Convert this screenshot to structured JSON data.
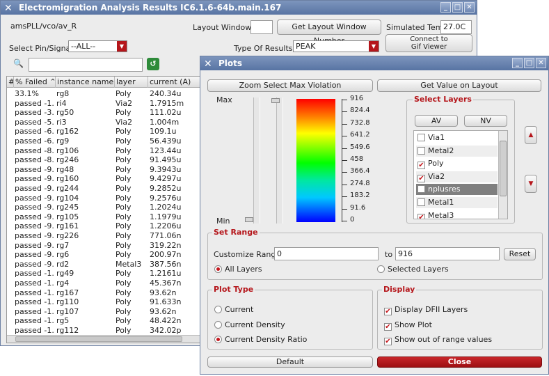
{
  "main_window": {
    "title": "Electromigration Analysis Results IC6.1.6-64b.main.167",
    "path": "amsPLL/vco/av_R",
    "layout_window_label": "Layout Window",
    "get_layout_window_button": "Get Layout Window Number",
    "simulated_temp_label": "Simulated Temp",
    "simulated_temp_value": "27.0C",
    "connect_gif_button_line1": "Connect to",
    "connect_gif_button_line2": "Gif Viewer",
    "select_pin_label": "Select Pin/Signal:",
    "select_pin_value": "--ALL--",
    "type_results_label": "Type Of Results:",
    "type_results_value": "PEAK",
    "columns": [
      "#",
      "% Failed",
      "instance name",
      "layer",
      "current (A)"
    ],
    "rows": [
      [
        "33.1%",
        "rg8",
        "Poly",
        "240.34u"
      ],
      [
        "passed -1...",
        "ri4",
        "Via2",
        "1.7915m"
      ],
      [
        "passed -3...",
        "rg50",
        "Poly",
        "111.02u"
      ],
      [
        "passed -5...",
        "ri3",
        "Via2",
        "1.004m"
      ],
      [
        "passed -6...",
        "rg162",
        "Poly",
        "109.1u"
      ],
      [
        "passed -6...",
        "rg9",
        "Poly",
        "56.439u"
      ],
      [
        "passed -8...",
        "rg106",
        "Poly",
        "123.44u"
      ],
      [
        "passed -8...",
        "rg246",
        "Poly",
        "91.495u"
      ],
      [
        "passed -9...",
        "rg48",
        "Poly",
        "9.3943u"
      ],
      [
        "passed -9...",
        "rg160",
        "Poly",
        "9.4297u"
      ],
      [
        "passed -9...",
        "rg244",
        "Poly",
        "9.2852u"
      ],
      [
        "passed -9...",
        "rg104",
        "Poly",
        "9.2576u"
      ],
      [
        "passed -9...",
        "rg245",
        "Poly",
        "1.2024u"
      ],
      [
        "passed -9...",
        "rg105",
        "Poly",
        "1.1979u"
      ],
      [
        "passed -9...",
        "rg161",
        "Poly",
        "1.2206u"
      ],
      [
        "passed -9...",
        "rg226",
        "Poly",
        "771.06n"
      ],
      [
        "passed -9...",
        "rg7",
        "Poly",
        "319.22n"
      ],
      [
        "passed -9...",
        "rg6",
        "Poly",
        "200.97n"
      ],
      [
        "passed -9...",
        "rd2",
        "Metal3",
        "387.56n"
      ],
      [
        "passed -1...",
        "rg49",
        "Poly",
        "1.2161u"
      ],
      [
        "passed -1...",
        "rg4",
        "Poly",
        "45.367n"
      ],
      [
        "passed -1...",
        "rg167",
        "Poly",
        "93.62n"
      ],
      [
        "passed -1...",
        "rg110",
        "Poly",
        "91.633n"
      ],
      [
        "passed -1...",
        "rg107",
        "Poly",
        "93.62n"
      ],
      [
        "passed -1...",
        "rg5",
        "Poly",
        "48.422n"
      ],
      [
        "passed -1...",
        "rg112",
        "Poly",
        "342.02p"
      ]
    ]
  },
  "plots_window": {
    "title": "Plots",
    "zoom_button": "Zoom Select Max Violation",
    "get_value_button": "Get Value on Layout",
    "max_label": "Max",
    "min_label": "Min",
    "scale_ticks": [
      "916",
      "824.4",
      "732.8",
      "641.2",
      "549.6",
      "458",
      "366.4",
      "274.8",
      "183.2",
      "91.6",
      "0"
    ],
    "select_layers_title": "Select Layers",
    "av_button": "AV",
    "nv_button": "NV",
    "layers": [
      {
        "name": "Via1",
        "checked": false,
        "selected": false
      },
      {
        "name": "Metal2",
        "checked": false,
        "selected": false
      },
      {
        "name": "Poly",
        "checked": true,
        "selected": false
      },
      {
        "name": "Via2",
        "checked": true,
        "selected": false
      },
      {
        "name": "nplusres",
        "checked": false,
        "selected": true
      },
      {
        "name": "Metal1",
        "checked": false,
        "selected": false
      },
      {
        "name": "Metal3",
        "checked": true,
        "selected": false
      }
    ],
    "set_range_title": "Set Range",
    "customize_range_label": "Customize Range",
    "range_from": "0",
    "range_to_label": "to",
    "range_to": "916",
    "reset_button": "Reset",
    "all_layers_label": "All Layers",
    "selected_layers_label": "Selected Layers",
    "plot_type_title": "Plot Type",
    "plot_types": [
      {
        "label": "Current",
        "selected": false
      },
      {
        "label": "Current Density",
        "selected": false
      },
      {
        "label": "Current Density Ratio",
        "selected": true
      }
    ],
    "display_title": "Display",
    "display_options": [
      {
        "label": "Display DFII Layers",
        "checked": true
      },
      {
        "label": "Show Plot",
        "checked": true
      },
      {
        "label": "Show out of range values",
        "checked": true
      }
    ],
    "default_button": "Default",
    "close_button": "Close"
  },
  "colors": {
    "accent_red": "#b5161b",
    "titlebar_blue": "#6b84b0"
  }
}
